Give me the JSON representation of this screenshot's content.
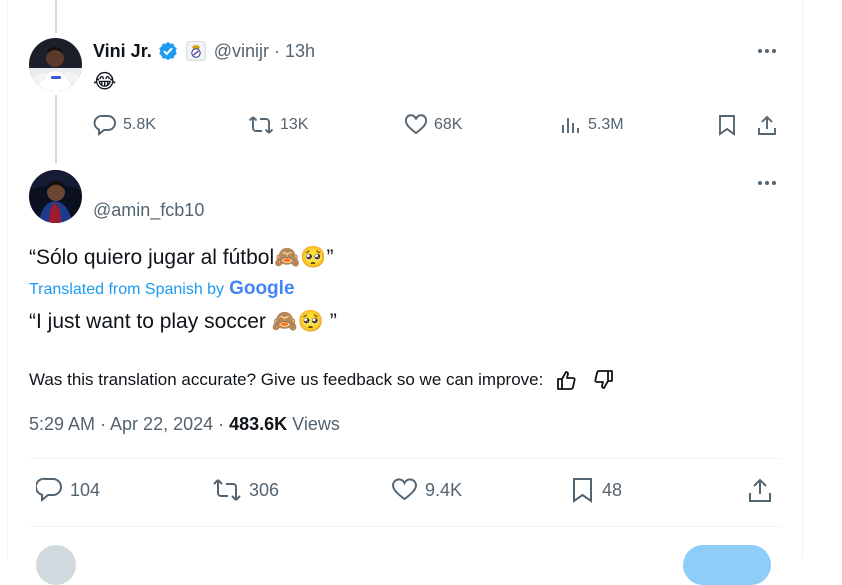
{
  "reply": {
    "display_name": "Vini Jr.",
    "handle": "@vinijr",
    "time": "· 13h",
    "text": "😂",
    "stats": {
      "replies": "5.8K",
      "reposts": "13K",
      "likes": "68K",
      "views": "5.3M"
    }
  },
  "main": {
    "handle": "@amin_fcb10",
    "original_text": "“Sólo quiero jugar al fútbol🙈🥺”",
    "translated_label": "Translated from Spanish by",
    "translator_brand": "Google",
    "translated_text": "“I just want to play soccer 🙈🥺 ”",
    "feedback_prompt": "Was this translation accurate? Give us feedback so we can improve:",
    "timestamp": "5:29 AM · Apr 22, 2024 ·",
    "views_count": "483.6K",
    "views_label": "Views",
    "stats": {
      "replies": "104",
      "reposts": "306",
      "likes": "9.4K",
      "bookmarks": "48"
    }
  },
  "colors": {
    "text": "#0f1419",
    "muted": "#536471",
    "link": "#1d9bf0",
    "verified": "#1d9bf0"
  }
}
